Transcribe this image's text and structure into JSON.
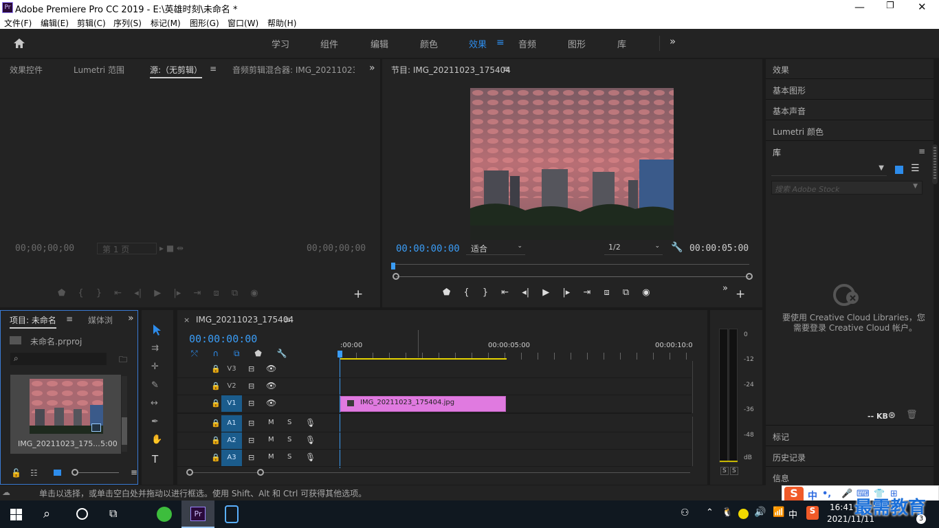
{
  "app": {
    "title": "Adobe Premiere Pro CC 2019 - E:\\英雄时刻\\未命名 *",
    "logo": "Pr",
    "window_controls": {
      "minimize": "—",
      "maximize": "❐",
      "close": "✕"
    }
  },
  "menu": [
    "文件(F)",
    "编辑(E)",
    "剪辑(C)",
    "序列(S)",
    "标记(M)",
    "图形(G)",
    "窗口(W)",
    "帮助(H)"
  ],
  "workspaces": {
    "items": [
      "学习",
      "组件",
      "编辑",
      "颜色",
      "效果",
      "音频",
      "图形",
      "库"
    ],
    "active": "效果",
    "overflow": "»"
  },
  "source_panel": {
    "tabs": [
      "效果控件",
      "Lumetri 范围",
      "源:（无剪辑）",
      "音频剪辑混合器: IMG_20211023"
    ],
    "active_tab": "源:（无剪辑）",
    "timecode_left": "00;00;00;00",
    "timecode_right": "00;00;00;00",
    "page": "第 1 页"
  },
  "program_panel": {
    "title": "节目: IMG_20211023_175404",
    "timecode": "00:00:00:00",
    "fit": "适合",
    "resolution": "1/2",
    "duration": "00:00:05:00"
  },
  "project_panel": {
    "tabs": [
      "项目: 未命名",
      "媒体浏"
    ],
    "file": "未命名.prproj",
    "search_placeholder": "",
    "thumbnail_name": "IMG_20211023_175...",
    "thumbnail_duration": "5:00"
  },
  "timeline": {
    "sequence_tab": "IMG_20211023_175404",
    "timecode": "00:00:00:00",
    "ruler_labels": [
      ":00:00",
      "00:00:05:00",
      "00:00:10:0"
    ],
    "video_tracks": [
      "V3",
      "V2",
      "V1"
    ],
    "audio_tracks": [
      "A1",
      "A2",
      "A3"
    ],
    "clip_name": "IMG_20211023_175404.jpg",
    "track_buttons": {
      "mute": "M",
      "solo": "S"
    }
  },
  "audio_meter": {
    "scale": [
      "0",
      "-12",
      "-24",
      "-36",
      "-48",
      "dB"
    ],
    "solo_buttons": [
      "S",
      "S"
    ]
  },
  "right_panel": {
    "items_top": [
      "效果",
      "基本图形",
      "基本声音",
      "Lumetri 颜色"
    ],
    "library_title": "库",
    "stock_search_placeholder": "搜索 Adobe Stock",
    "cc_message_line1": "要使用 Creative Cloud Libraries，您",
    "cc_message_line2": "需要登录 Creative Cloud 帐户。",
    "storage": "-- KB",
    "items_bottom": [
      "标记",
      "历史记录",
      "信息"
    ]
  },
  "status_bar": {
    "text": "单击以选择，或单击空白处并拖动以进行框选。使用 Shift、Alt 和 Ctrl 可获得其他选项。"
  },
  "ime_toolbar": {
    "label": "中",
    "punct": "•,"
  },
  "taskbar": {
    "time": "16:41",
    "date": "2021/11/11",
    "ime": "中",
    "notification_count": "3",
    "watermark": "最需教育"
  },
  "colors": {
    "accent": "#2d8ceb",
    "clip": "#e07ae0",
    "track_button": "#1b5c8c",
    "workarea": "#e6d400"
  }
}
